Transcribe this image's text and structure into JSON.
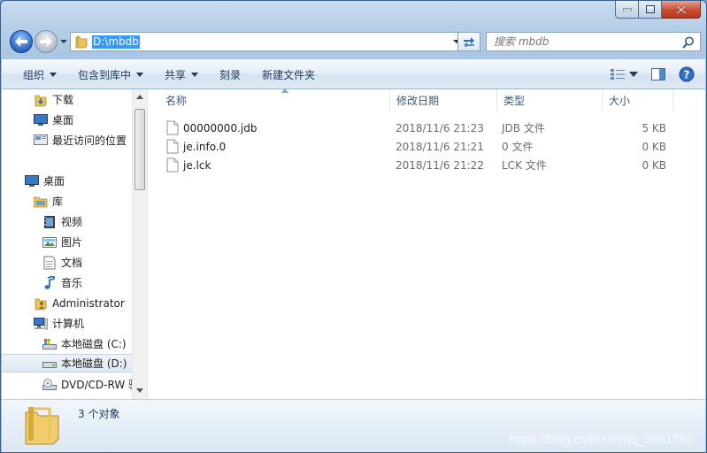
{
  "address": {
    "path": "D:\\mbdb"
  },
  "search": {
    "placeholder": "搜索 mbdb"
  },
  "toolbar": {
    "organize": "组织",
    "include_in_library": "包含到库中",
    "share": "共享",
    "burn": "刻录",
    "new_folder": "新建文件夹"
  },
  "nav": {
    "favorites": [
      {
        "label": "下载",
        "icon": "downloads-folder-icon"
      },
      {
        "label": "桌面",
        "icon": "desktop-icon"
      },
      {
        "label": "最近访问的位置",
        "icon": "recent-places-icon"
      }
    ],
    "desktop": "桌面",
    "libraries": "库",
    "library_items": [
      {
        "label": "视频",
        "icon": "video-library-icon"
      },
      {
        "label": "图片",
        "icon": "picture-library-icon"
      },
      {
        "label": "文档",
        "icon": "document-library-icon"
      },
      {
        "label": "音乐",
        "icon": "music-library-icon"
      }
    ],
    "user": "Administrator",
    "computer": "计算机",
    "drives": [
      {
        "label": "本地磁盘 (C:)",
        "icon": "system-drive-icon"
      },
      {
        "label": "本地磁盘 (D:)",
        "icon": "drive-icon"
      },
      {
        "label": "DVD/CD-RW 驱",
        "icon": "dvd-drive-icon"
      }
    ]
  },
  "columns": {
    "name": "名称",
    "modified": "修改日期",
    "type": "类型",
    "size": "大小"
  },
  "files": [
    {
      "name": "00000000.jdb",
      "modified": "2018/11/6 21:23",
      "type": "JDB 文件",
      "size": "5 KB"
    },
    {
      "name": "je.info.0",
      "modified": "2018/11/6 21:21",
      "type": "0 文件",
      "size": "0 KB"
    },
    {
      "name": "je.lck",
      "modified": "2018/11/6 21:22",
      "type": "LCK 文件",
      "size": "0 KB"
    }
  ],
  "status": {
    "count": "3 个对象"
  },
  "watermark": "https://blog.csdn.net/qq_3861753"
}
